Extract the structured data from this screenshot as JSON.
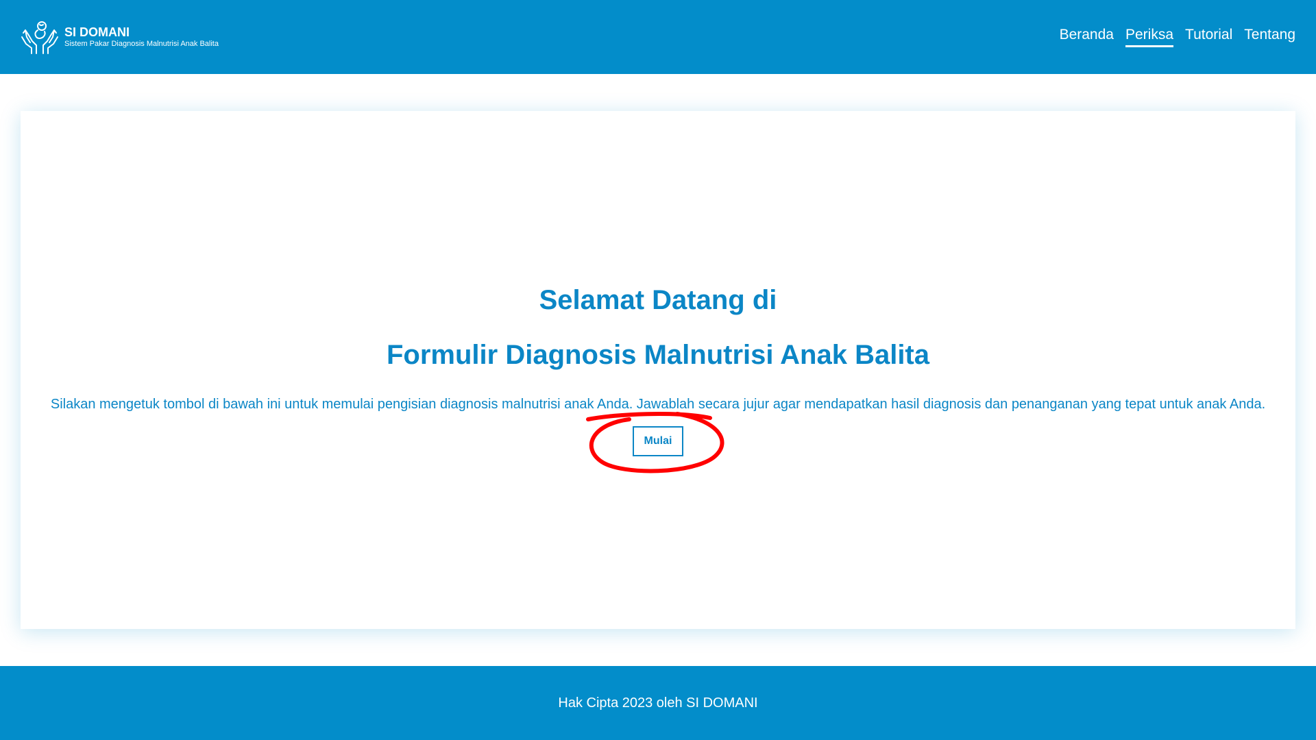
{
  "brand": {
    "title": "SI DOMANI",
    "subtitle": "Sistem Pakar Diagnosis Malnutrisi Anak Balita",
    "logo_icon": "hands-holding-baby-icon"
  },
  "nav": {
    "items": [
      {
        "label": "Beranda",
        "active": false
      },
      {
        "label": "Periksa",
        "active": true
      },
      {
        "label": "Tutorial",
        "active": false
      },
      {
        "label": "Tentang",
        "active": false
      }
    ]
  },
  "main": {
    "title_line1": "Selamat Datang di",
    "title_line2": "Formulir Diagnosis Malnutrisi Anak Balita",
    "description": "Silakan mengetuk tombol di bawah ini untuk memulai pengisian diagnosis malnutrisi anak Anda. Jawablah secara jujur agar mendapatkan hasil diagnosis dan penanganan yang tepat untuk anak Anda.",
    "start_button": "Mulai"
  },
  "footer": {
    "text": "Hak Cipta 2023 oleh SI DOMANI"
  },
  "colors": {
    "primary": "#038dca",
    "text_accent": "#0b86c6",
    "annotation": "#ff0000"
  }
}
